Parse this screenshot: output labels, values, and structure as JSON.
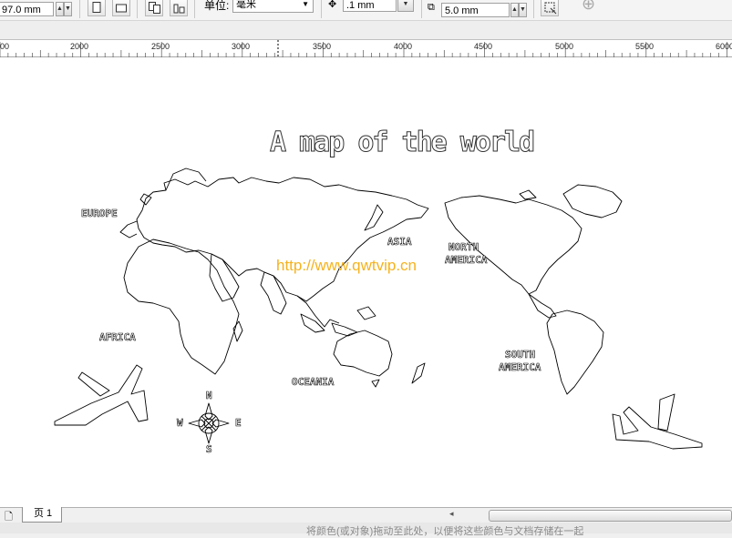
{
  "toolbar": {
    "height_value": "97.0 mm",
    "units_label": "单位:",
    "units_value": "毫米",
    "nudge_value": ".1 mm",
    "duplicate_value": "5.0 mm"
  },
  "ruler": {
    "labels": [
      "00",
      "2000",
      "2500",
      "3000",
      "3500",
      "4000",
      "4500",
      "5000",
      "5500",
      "6000"
    ]
  },
  "document": {
    "title": "A map of the world",
    "watermark": "http://www.qwtvip.cn",
    "labels": {
      "europe": "EUROPE",
      "asia": "ASIA",
      "north_america_1": "NORTH",
      "north_america_2": "AMERICA",
      "africa": "AFRICA",
      "oceania": "OCEANIA",
      "south_america_1": "SOUTH",
      "south_america_2": "AMERICA"
    },
    "compass": {
      "n": "N",
      "s": "S",
      "e": "E",
      "w": "W"
    }
  },
  "pagebar": {
    "page_tab": "页 1"
  },
  "status": {
    "hint": "将颜色(或对象)拖动至此处，以便将这些颜色与文档存储在一起"
  },
  "colors": {
    "watermark": "#f5b21e",
    "canvas": "#ffffff",
    "chrome": "#f0f0f0"
  }
}
